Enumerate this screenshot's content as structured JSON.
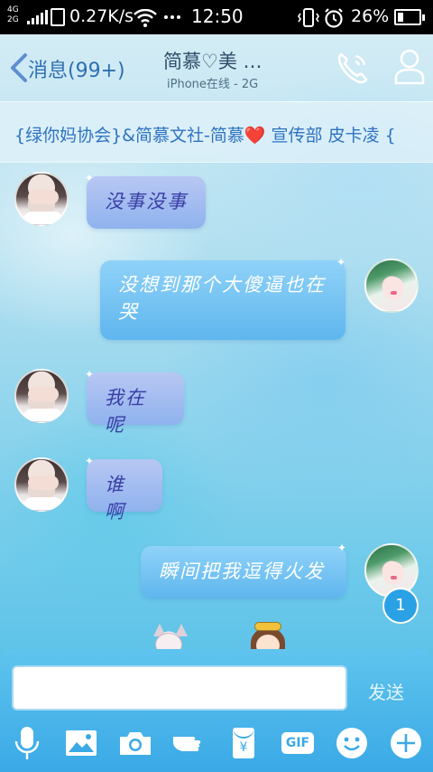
{
  "status_bar": {
    "network": "4G\n2G",
    "speed": "0.27K/s",
    "time": "12:50",
    "battery": "26%",
    "battery_level": 0.26
  },
  "header": {
    "back_label": "消息(99+)",
    "title": "简慕♡美 …",
    "subtitle": "iPhone在线 - 2G",
    "icons": [
      "back-chevron-icon",
      "phone-icon",
      "person-icon"
    ]
  },
  "banner": {
    "text": "{绿你妈协会}&简慕文社-简慕❤️ 宣传部 皮卡凌 {"
  },
  "messages": [
    {
      "side": "left",
      "text": "没事没事"
    },
    {
      "side": "right",
      "text": "没想到那个大傻逼也在哭"
    },
    {
      "side": "left",
      "text": "我在呢"
    },
    {
      "side": "left",
      "text": "谁啊"
    },
    {
      "side": "right",
      "text": "瞬间把我逗得火发"
    }
  ],
  "unread_badge": "1",
  "composer": {
    "placeholder": "",
    "send_label": "发送",
    "tools": [
      "microphone-icon",
      "image-icon",
      "camera-icon",
      "poke-hand-icon",
      "red-packet-icon",
      "gif-icon",
      "emoji-icon",
      "plus-icon"
    ],
    "gif_label": "GIF",
    "yen_label": "¥"
  },
  "colors": {
    "status_bar_bg": "#000000",
    "accent": "#2f73c0",
    "composer_bg": "#3aa9e6",
    "left_bubble": "#8fb2ee",
    "right_bubble": "#5fb6ee"
  }
}
